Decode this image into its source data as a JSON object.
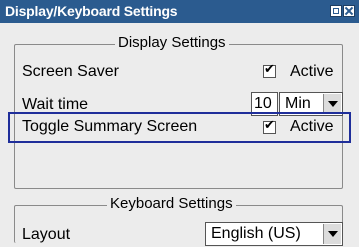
{
  "window": {
    "title": "Display/Keyboard Settings"
  },
  "display_settings": {
    "legend": "Display Settings",
    "screen_saver": {
      "label": "Screen Saver",
      "checked": true,
      "checkbox_label": "Active"
    },
    "wait_time": {
      "label": "Wait time",
      "value": "10",
      "unit": "Min"
    },
    "toggle_summary": {
      "label": "Toggle Summary Screen",
      "checked": true,
      "checkbox_label": "Active"
    }
  },
  "keyboard_settings": {
    "legend": "Keyboard Settings",
    "layout": {
      "label": "Layout",
      "value": "English (US)"
    }
  },
  "colors": {
    "titlebar": "#2b5b8f",
    "focus_border": "#1f2e9a",
    "background": "#ececec"
  }
}
